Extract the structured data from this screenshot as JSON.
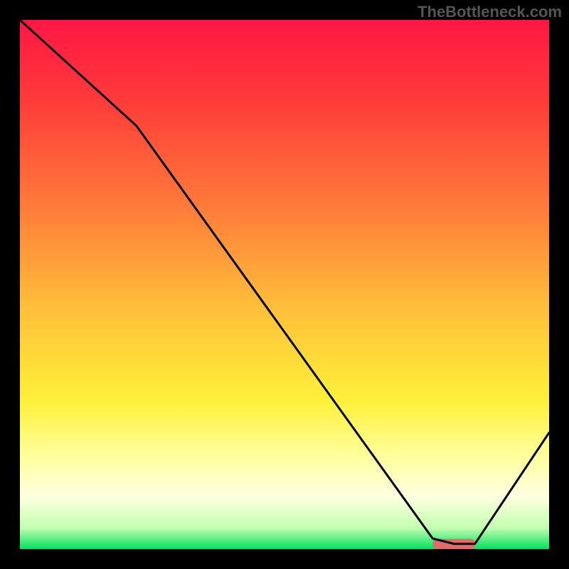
{
  "watermark": "TheBottleneck.com",
  "chart_data": {
    "type": "line",
    "title": "",
    "xlabel": "",
    "ylabel": "",
    "xlim": [
      0,
      100
    ],
    "ylim": [
      0,
      100
    ],
    "grid": false,
    "legend": false,
    "series": [
      {
        "name": "curve",
        "x": [
          0,
          22,
          78,
          82,
          86,
          100
        ],
        "values": [
          100,
          80,
          2,
          1,
          1,
          22
        ]
      }
    ],
    "marker": {
      "name": "optimal-region",
      "x_start": 78,
      "x_end": 86,
      "y": 1,
      "color": "#e26b6b"
    },
    "background_gradient": {
      "stops": [
        {
          "pos": 0.0,
          "color": "#ff1744"
        },
        {
          "pos": 0.15,
          "color": "#ff3a3a"
        },
        {
          "pos": 0.35,
          "color": "#ff7a3a"
        },
        {
          "pos": 0.55,
          "color": "#ffc13a"
        },
        {
          "pos": 0.72,
          "color": "#fff03a"
        },
        {
          "pos": 0.82,
          "color": "#ffff9a"
        },
        {
          "pos": 0.9,
          "color": "#ffffe0"
        },
        {
          "pos": 0.96,
          "color": "#c2ffb0"
        },
        {
          "pos": 1.0,
          "color": "#00e060"
        }
      ]
    }
  }
}
